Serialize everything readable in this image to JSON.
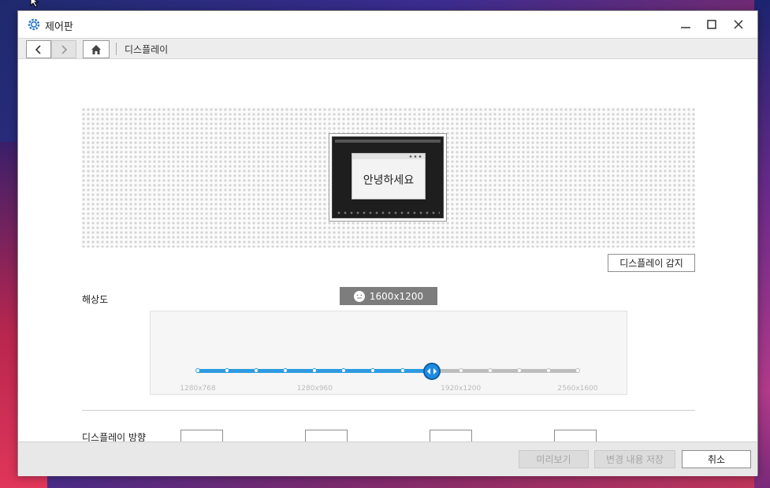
{
  "window": {
    "title": "제어판",
    "minimize_glyph": "minimize-icon",
    "maximize_glyph": "maximize-icon",
    "close_glyph": "close-icon"
  },
  "navbar": {
    "breadcrumb": "디스플레이"
  },
  "preview": {
    "mini_window_text": "안녕하세요"
  },
  "detect_button": "디스플레이 감지",
  "resolution": {
    "label": "해상도",
    "current": "1600x1200",
    "tick_count": 14,
    "selected_index": 8,
    "tick_labels": [
      {
        "text": "1280x768",
        "index": 0
      },
      {
        "text": "1280x960",
        "index": 4
      },
      {
        "text": "1920x1200",
        "index": 9
      },
      {
        "text": "2560x1600",
        "index": 13
      }
    ]
  },
  "orientation": {
    "label": "디스플레이 방향",
    "options_count": 4
  },
  "footer": {
    "preview_button": "미리보기",
    "save_button": "변경 내용 저장",
    "cancel_button": "취소"
  },
  "colors": {
    "accent": "#2d9be0",
    "badge": "#7d7d7d"
  }
}
